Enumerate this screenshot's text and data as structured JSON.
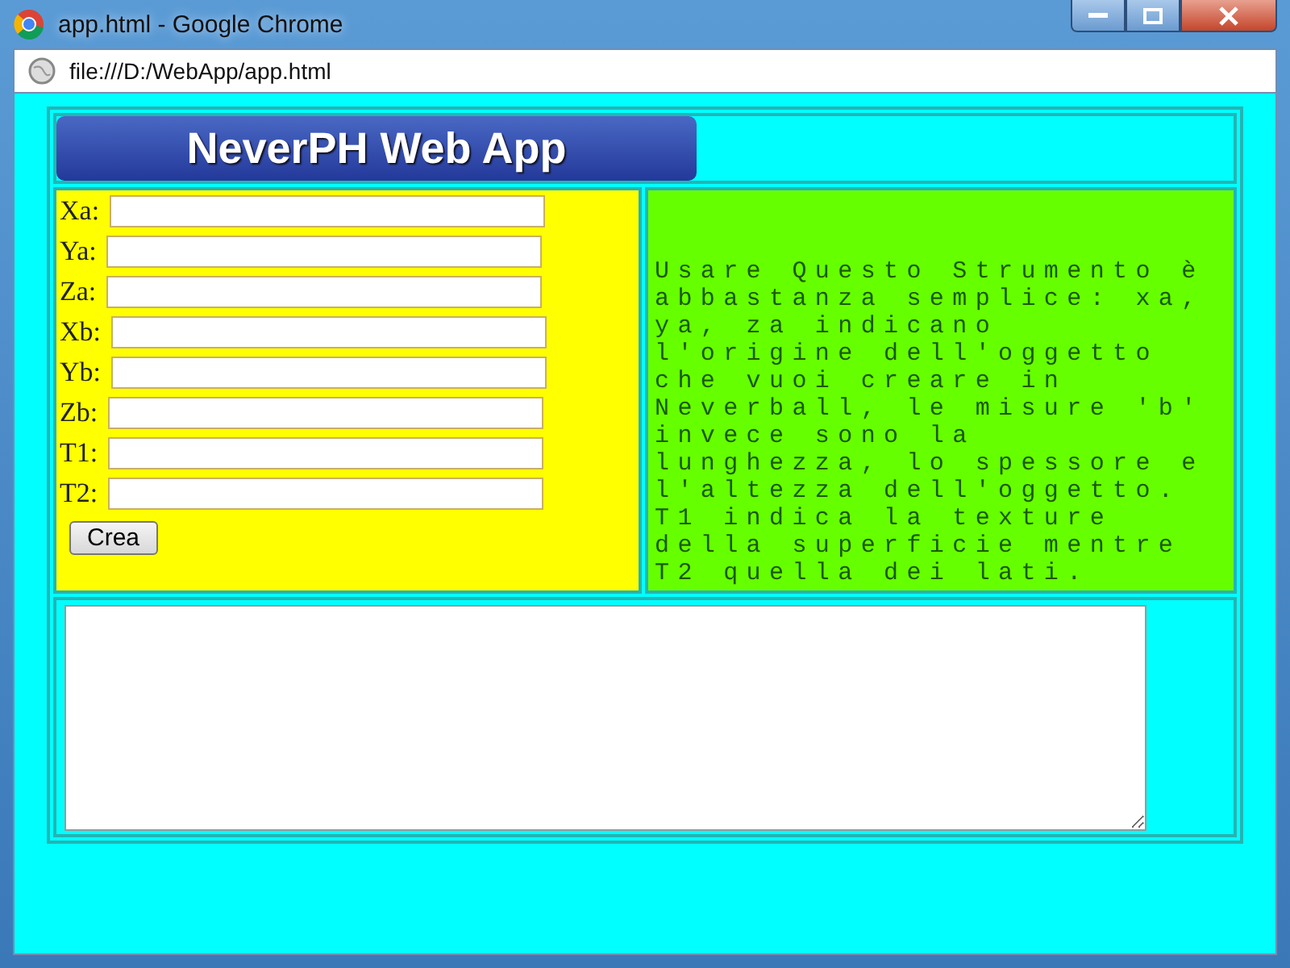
{
  "window": {
    "title": "app.html - Google Chrome"
  },
  "address_bar": {
    "url": "file:///D:/WebApp/app.html"
  },
  "banner": {
    "title": "NeverPH Web App"
  },
  "form": {
    "fields": [
      {
        "label": "Xa:"
      },
      {
        "label": "Ya:"
      },
      {
        "label": "Za:"
      },
      {
        "label": "Xb:"
      },
      {
        "label": "Yb:"
      },
      {
        "label": "Zb:"
      },
      {
        "label": "T1:"
      },
      {
        "label": "T2:"
      }
    ],
    "button": "Crea"
  },
  "instructions": "Usare Questo Strumento è abbastanza semplice: xa, ya, za indicano l'origine dell'oggetto che vuoi creare in Neverball, le misure 'b' invece sono la lunghezza, lo spessore e l'altezza dell'oggetto. T1 indica la texture della superficie mentre T2 quella dei lati.",
  "output": {
    "kind": "textarea"
  }
}
